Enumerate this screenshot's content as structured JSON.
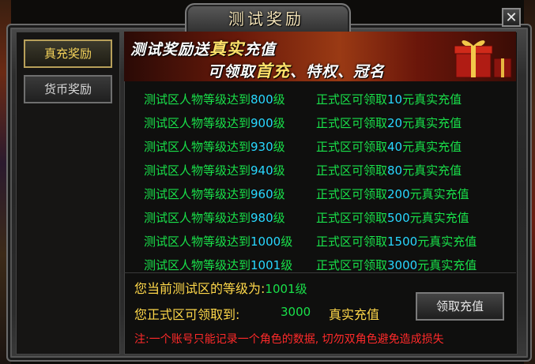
{
  "window": {
    "title": "测试奖励",
    "close_label": "✕"
  },
  "sidebar": {
    "items": [
      {
        "label": "真充奖励",
        "active": true
      },
      {
        "label": "货币奖励",
        "active": false
      }
    ]
  },
  "banner": {
    "line1_prefix": "测试奖励送",
    "line1_highlight": "真实",
    "line1_suffix": "充值",
    "line2_prefix": "可领取",
    "line2_highlight": "首充",
    "line2_suffix": "、特权、冠名"
  },
  "rewards": [
    {
      "left_prefix": "测试区人物等级达到",
      "level": "800",
      "left_suffix": "级",
      "right_prefix": "正式区可领取",
      "amount": "10",
      "right_suffix": "元真实充值"
    },
    {
      "left_prefix": "测试区人物等级达到",
      "level": "900",
      "left_suffix": "级",
      "right_prefix": "正式区可领取",
      "amount": "20",
      "right_suffix": "元真实充值"
    },
    {
      "left_prefix": "测试区人物等级达到",
      "level": "930",
      "left_suffix": "级",
      "right_prefix": "正式区可领取",
      "amount": "40",
      "right_suffix": "元真实充值"
    },
    {
      "left_prefix": "测试区人物等级达到",
      "level": "940",
      "left_suffix": "级",
      "right_prefix": "正式区可领取",
      "amount": "80",
      "right_suffix": "元真实充值"
    },
    {
      "left_prefix": "测试区人物等级达到",
      "level": "960",
      "left_suffix": "级",
      "right_prefix": "正式区可领取",
      "amount": "200",
      "right_suffix": "元真实充值"
    },
    {
      "left_prefix": "测试区人物等级达到",
      "level": "980",
      "left_suffix": "级",
      "right_prefix": "正式区可领取",
      "amount": "500",
      "right_suffix": "元真实充值"
    },
    {
      "left_prefix": "测试区人物等级达到",
      "level": "1000",
      "left_suffix": "级",
      "right_prefix": "正式区可领取",
      "amount": "1500",
      "right_suffix": "元真实充值"
    },
    {
      "left_prefix": "测试区人物等级达到",
      "level": "1001",
      "left_suffix": "级",
      "right_prefix": "正式区可领取",
      "amount": "3000",
      "right_suffix": "元真实充值"
    }
  ],
  "status": {
    "current_level_label": "您当前测试区的等级为:",
    "current_level_value": "1001级",
    "claimable_label": "您正式区可领取到:",
    "claimable_amount": "3000",
    "claimable_unit": "真实充值"
  },
  "claim_button": {
    "label": "领取充值"
  },
  "notice": "注:一个账号只能记录一个角色的数据, 切勿双角色避免造成损失",
  "colors": {
    "green_text": "#19e14a",
    "cyan_number": "#28d7ff",
    "yellow_text": "#ffd84a",
    "red_notice": "#ff2a2a"
  }
}
